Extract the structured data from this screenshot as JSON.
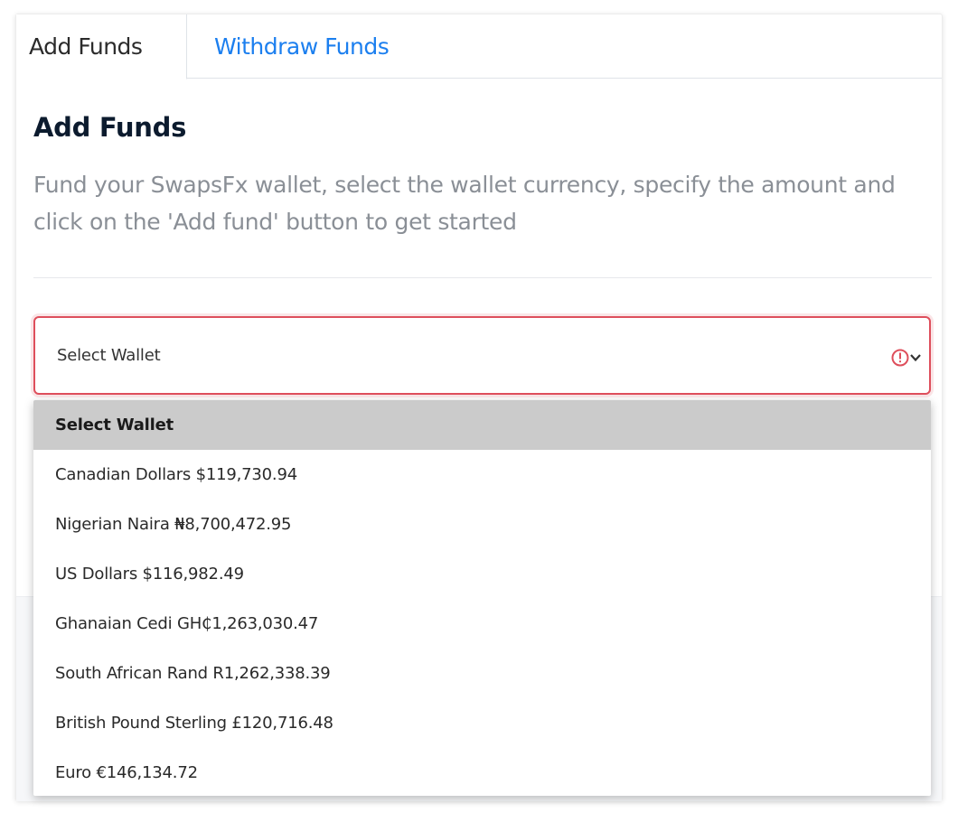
{
  "tabs": [
    {
      "label": "Add Funds",
      "active": true
    },
    {
      "label": "Withdraw Funds",
      "active": false
    }
  ],
  "section": {
    "title": "Add Funds",
    "description": "Fund your SwapsFx wallet, select the wallet currency, specify the amount and click on the 'Add fund' button to get started"
  },
  "wallet_select": {
    "value": "Select Wallet",
    "state": "invalid",
    "icons": [
      "warning-icon",
      "chevron-down-icon"
    ]
  },
  "wallet_options": [
    {
      "label": "Select Wallet",
      "selected": true
    },
    {
      "label": "Canadian Dollars $119,730.94",
      "selected": false
    },
    {
      "label": "Nigerian Naira ₦8,700,472.95",
      "selected": false
    },
    {
      "label": "US Dollars $116,982.49",
      "selected": false
    },
    {
      "label": "Ghanaian Cedi GH₵1,263,030.47",
      "selected": false
    },
    {
      "label": "South African Rand R1,262,338.39",
      "selected": false
    },
    {
      "label": "British Pound Sterling £120,716.48",
      "selected": false
    },
    {
      "label": "Euro €146,134.72",
      "selected": false
    }
  ],
  "colors": {
    "accent_blue": "#1c7fef",
    "error_red": "#de4f5c",
    "selected_option_bg": "#cbcbcb"
  }
}
